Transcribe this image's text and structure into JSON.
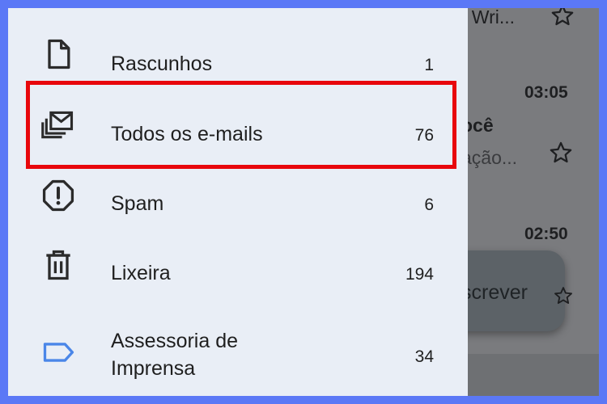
{
  "drawer": {
    "items": [
      {
        "label": "Rascunhos",
        "count": "1",
        "icon": "draft-icon"
      },
      {
        "label": "Todos os e-mails",
        "count": "76",
        "icon": "all-mail-icon"
      },
      {
        "label": "Spam",
        "count": "6",
        "icon": "spam-icon"
      },
      {
        "label": "Lixeira",
        "count": "194",
        "icon": "trash-icon"
      },
      {
        "label_line1": "Assessoria de",
        "label_line2": "Imprensa",
        "count": "34",
        "icon": "label-tag-icon"
      }
    ]
  },
  "background": {
    "top_snippet": "t Wri...",
    "time1": "03:05",
    "sender_fragment": "ocê",
    "preview_fragment": "ação...",
    "time2": "02:50",
    "compose_label": "screver"
  },
  "colors": {
    "highlight_border": "#e8070c",
    "drawer_bg": "#e9eef6",
    "frame": "#5b78f6",
    "label_icon": "#4a86e8"
  }
}
